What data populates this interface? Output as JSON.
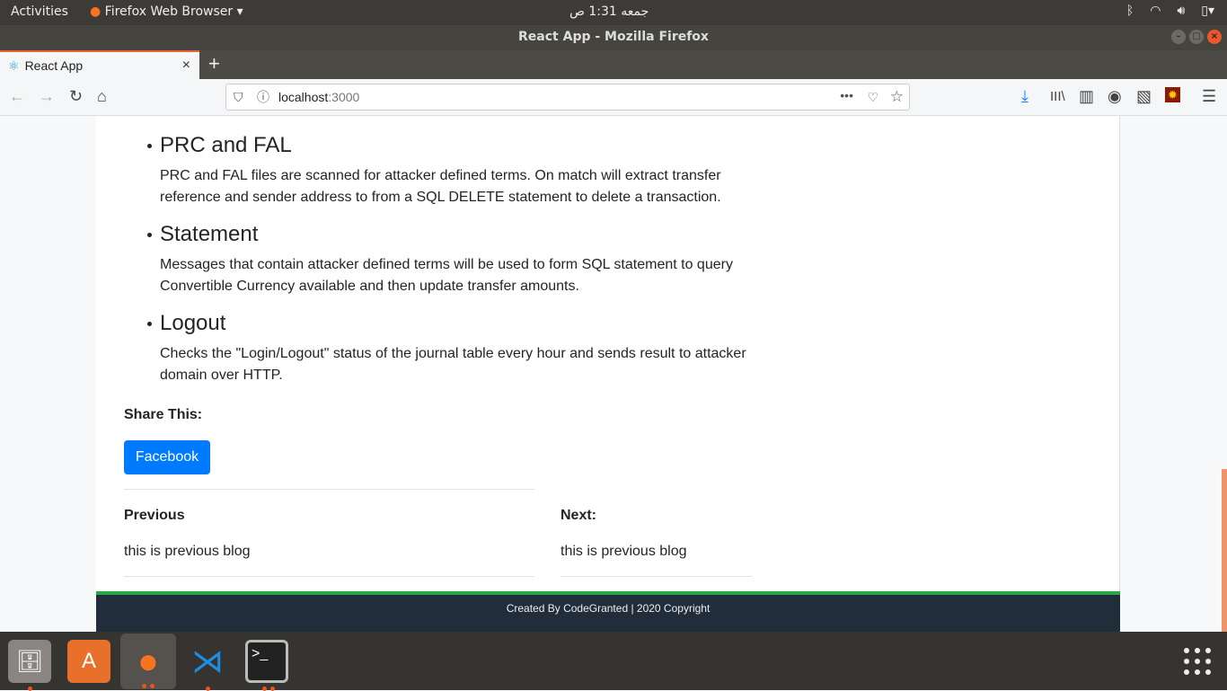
{
  "system": {
    "activities": "Activities",
    "app_menu": "Firefox Web Browser ▾",
    "clock": "جمعه  1:31 ص"
  },
  "window": {
    "title": "React App - Mozilla Firefox"
  },
  "tab": {
    "label": "React App",
    "close": "×",
    "new": "+"
  },
  "url": {
    "host": "localhost",
    "port": ":3000"
  },
  "features": [
    {
      "title": "PRC and FAL",
      "text": "PRC and FAL files are scanned for attacker defined terms. On match will extract transfer reference and sender address to from a SQL DELETE statement to delete a transaction."
    },
    {
      "title": "Statement",
      "text": "Messages that contain attacker defined terms will be used to form SQL statement to query Convertible Currency available and then update transfer amounts."
    },
    {
      "title": "Logout",
      "text": "Checks the \"Login/Logout\" status of the journal table every hour and sends result to attacker domain over HTTP."
    }
  ],
  "share": {
    "label": "Share This:",
    "facebook": "Facebook",
    "color": "#007bff"
  },
  "post_nav": {
    "previous_label": "Previous",
    "previous_text": "this is previous blog",
    "next_label": "Next:",
    "next_text": "this is previous blog"
  },
  "footer": {
    "text": "Created By CodeGranted | 2020 Copyright",
    "accent": "#28a745"
  }
}
